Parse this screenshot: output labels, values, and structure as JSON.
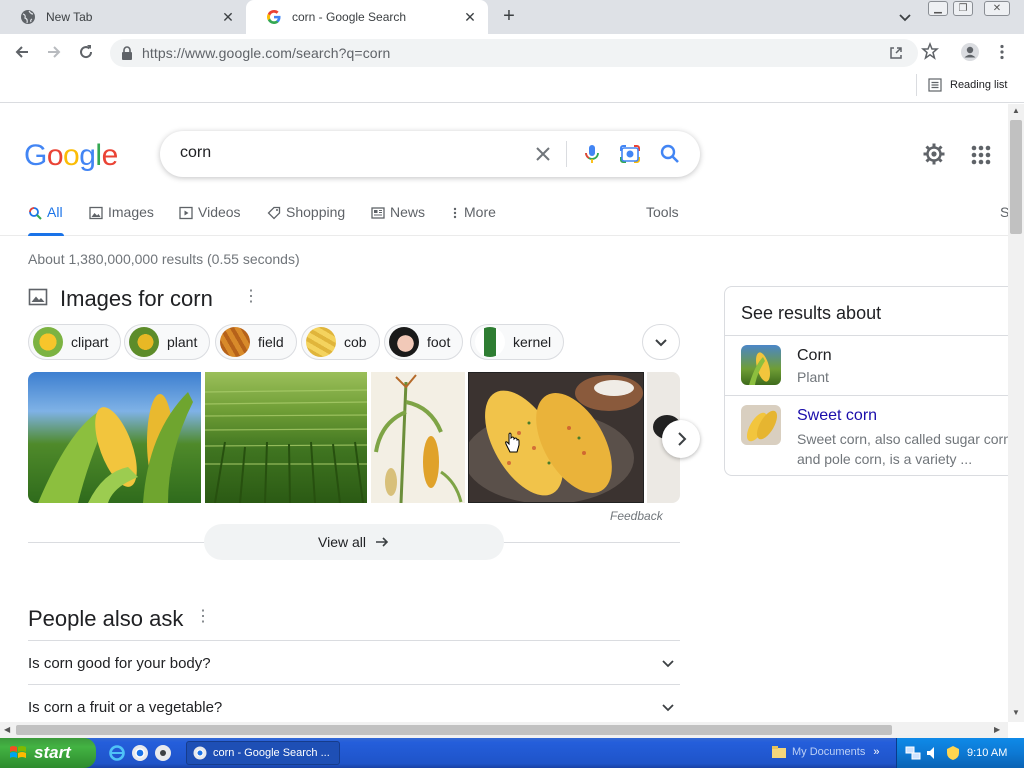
{
  "browser": {
    "tabs": [
      {
        "title": "New Tab"
      },
      {
        "title": "corn - Google Search"
      }
    ],
    "url": "https://www.google.com/search?q=corn",
    "reading_list_label": "Reading list"
  },
  "search": {
    "logo_text": "Google",
    "query": "corn",
    "tabs": [
      "All",
      "Images",
      "Videos",
      "Shopping",
      "News",
      "More"
    ],
    "tools_label": "Tools",
    "result_stats": "About 1,380,000,000 results (0.55 seconds)",
    "edge_letter": "S"
  },
  "images_section": {
    "title": "Images for corn",
    "chips": [
      "clipart",
      "plant",
      "field",
      "cob",
      "foot",
      "kernel"
    ],
    "feedback_label": "Feedback",
    "view_all_label": "View all"
  },
  "people_also_ask": {
    "title": "People also ask",
    "questions": [
      "Is corn good for your body?",
      "Is corn a fruit or a vegetable?"
    ]
  },
  "knowledge_panel": {
    "title": "See results about",
    "entries": [
      {
        "name": "Corn",
        "subtitle": "Plant"
      },
      {
        "name": "Sweet corn",
        "description_line1": "Sweet corn, also called sugar corn",
        "description_line2": "and pole corn, is a variety ..."
      }
    ]
  },
  "taskbar": {
    "start_label": "start",
    "active_task": "corn - Google Search ...",
    "my_documents": "My Documents",
    "clock": "9:10 AM"
  },
  "colors": {
    "accent_blue": "#1a73e8",
    "link_blue": "#1a0dab",
    "google_blue": "#4285f4",
    "google_red": "#ea4335",
    "google_yellow": "#fbbc05",
    "google_green": "#34a853"
  }
}
